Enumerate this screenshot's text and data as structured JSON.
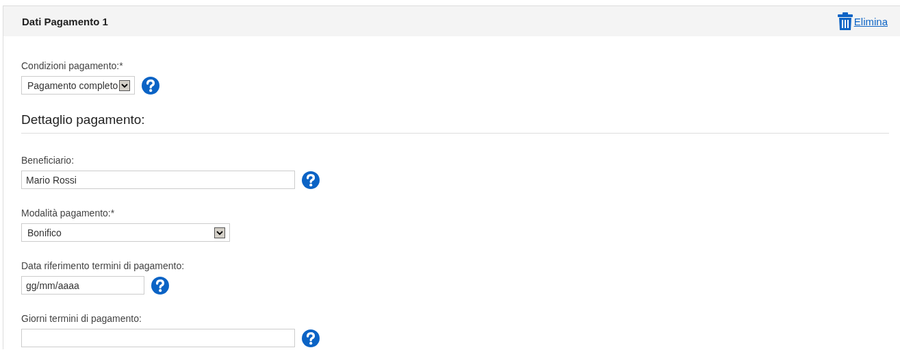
{
  "panel": {
    "title": "Dati Pagamento 1",
    "delete_link": "Elimina"
  },
  "conditions": {
    "label": "Condizioni pagamento:*",
    "kind": "select",
    "value": "Pagamento completo",
    "help": true
  },
  "section_heading": "Dettaglio pagamento:",
  "fields": [
    {
      "label": "Beneficiario:",
      "kind": "text",
      "value": "Mario Rossi",
      "help": true
    },
    {
      "label": "Modalità pagamento:*",
      "kind": "select",
      "value": "Bonifico",
      "help": false
    },
    {
      "label": "Data riferimento termini di pagamento:",
      "kind": "text",
      "value": "gg/mm/aaaa",
      "help": true
    },
    {
      "label": "Giorni termini di pagamento:",
      "kind": "text",
      "help": true
    }
  ]
}
